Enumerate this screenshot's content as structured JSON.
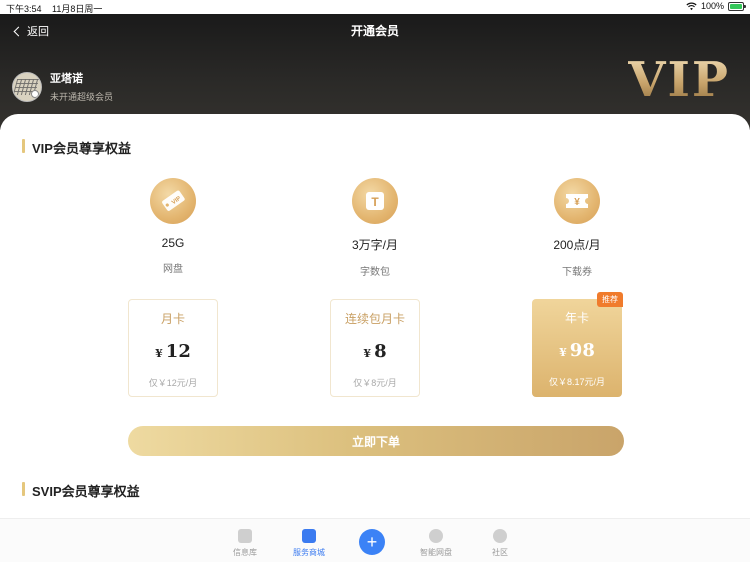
{
  "status_bar": {
    "time": "下午3:54",
    "date": "11月8日周一",
    "battery": "100%"
  },
  "nav": {
    "back_label": "返回",
    "title": "开通会员"
  },
  "user": {
    "name": "亚塔诺",
    "status": "未开通超级会员"
  },
  "header_badge": "VIP",
  "vip_section": {
    "title": "VIP会员尊享权益",
    "benefits": [
      {
        "value": "25G",
        "label": "网盘",
        "icon": "vip-tag-icon",
        "icon_text": "VIP"
      },
      {
        "value": "3万字/月",
        "label": "字数包",
        "icon": "text-t-icon",
        "icon_text": "T"
      },
      {
        "value": "200点/月",
        "label": "下载券",
        "icon": "ticket-yen-icon",
        "icon_text": "¥"
      }
    ],
    "plans": [
      {
        "name": "月卡",
        "currency": "¥",
        "price": "12",
        "note": "仅￥12元/月",
        "selected": false
      },
      {
        "name": "连续包月卡",
        "currency": "¥",
        "price": "8",
        "note": "仅￥8元/月",
        "selected": false
      },
      {
        "name": "年卡",
        "currency": "¥",
        "price": "98",
        "note": "仅￥8.17元/月",
        "selected": true,
        "tag": "推荐"
      }
    ],
    "order_button": "立即下单"
  },
  "svip_section": {
    "title": "SVIP会员尊享权益"
  },
  "tab_bar": {
    "items": [
      {
        "label": "信息库",
        "icon": "library-icon",
        "active": false
      },
      {
        "label": "服务商城",
        "icon": "store-icon",
        "active": true
      },
      {
        "label": "智能网盘",
        "icon": "cloud-icon",
        "active": false
      },
      {
        "label": "社区",
        "icon": "chat-icon",
        "active": false
      }
    ],
    "center_button": "+"
  },
  "colors": {
    "accent_gold": "#dcb36d",
    "tag_orange": "#f07b2c",
    "tab_active": "#3b7bf0"
  }
}
